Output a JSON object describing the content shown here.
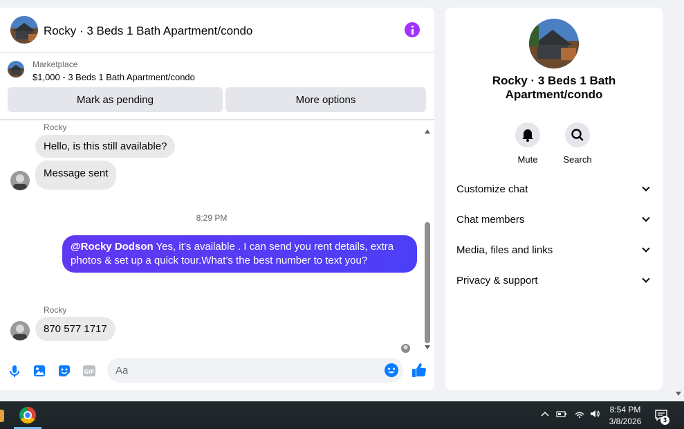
{
  "header": {
    "title": "Rocky · 3 Beds 1 Bath Apartment/condo"
  },
  "marketplace": {
    "label": "Marketplace",
    "listing": "$1,000 - 3 Beds 1 Bath Apartment/condo",
    "pending_label": "Mark as pending",
    "more_label": "More options"
  },
  "messages": {
    "sender_top": "Rocky",
    "msg1": "Hello, is this still available?",
    "msg2": "Message sent",
    "timestamp": "8:29 PM",
    "out_mention": "@Rocky Dodson",
    "out_text": " Yes, it’s available .  I can send you rent details, extra photos & set up a quick tour.What’s the best number to text you?",
    "sender_bottom": "Rocky",
    "msg3": "870 577 1717"
  },
  "composer": {
    "placeholder": "Aa"
  },
  "info": {
    "name": "Rocky · 3 Beds 1 Bath Apartment/condo",
    "mute_label": "Mute",
    "search_label": "Search",
    "sections": [
      "Customize chat",
      "Chat members",
      "Media, files and links",
      "Privacy & support"
    ]
  },
  "taskbar": {
    "time": "8:54 PM",
    "date": "3/8/2026",
    "notifications": "3"
  },
  "colors": {
    "accent": "#a033ff",
    "outgoing_bubble": "#5b3cf5",
    "icon_blue": "#0a7cff"
  }
}
